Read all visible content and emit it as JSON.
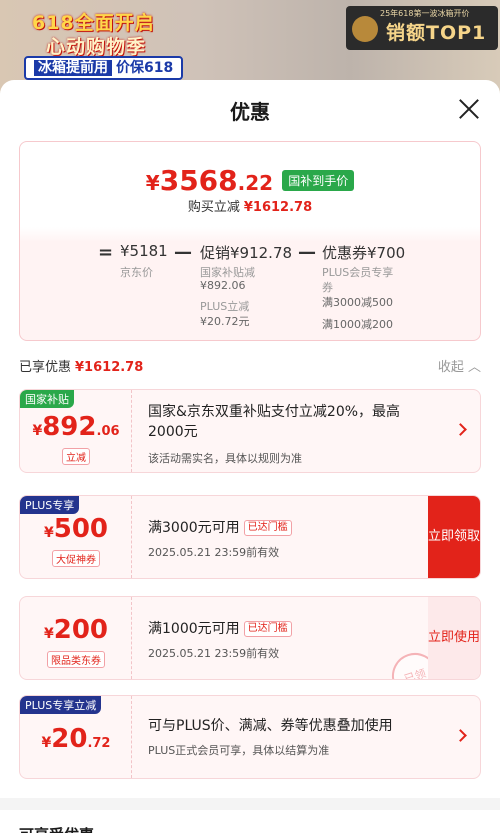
{
  "banner": {
    "left_line1": "618全面开启",
    "left_line2": "心动购物季",
    "left_tag_highlight": "冰箱提前用",
    "left_tag_text": "价保618",
    "right_small": "25年618第一波冰箱开价",
    "right_big": "销额TOP1"
  },
  "sheet": {
    "title": "优惠"
  },
  "price": {
    "symbol": "¥",
    "final_int": "3568",
    "final_dec": ".22",
    "badge": "国补到手价",
    "sub_label": "购买立减",
    "sub_amount": "¥1612.78"
  },
  "formula": {
    "eq": "=",
    "minus": "—",
    "jd_value": "¥5181",
    "jd_label": "京东价",
    "promo_value": "促销¥912.78",
    "promo_sub1_label": "国家补贴减",
    "promo_sub1_value": "¥892.06",
    "promo_sub2_label": "PLUS立减",
    "promo_sub2_value": "¥20.72元",
    "coupon_value": "优惠券¥700",
    "coupon_sub1_label": "PLUS会员专享",
    "coupon_sub1_label2": "券",
    "coupon_sub2": "满3000减500",
    "coupon_sub3": "满1000减200"
  },
  "enjoyed": {
    "label": "已享优惠",
    "amount": "¥1612.78",
    "collapse": "收起"
  },
  "cards": [
    {
      "tag": "国家补贴",
      "symbol": "¥",
      "int": "892",
      "dec": ".06",
      "label": "立减",
      "title_line1": "国家&京东双重补贴支付立减20%，最高",
      "title_line2": "2000元",
      "desc": "该活动需实名，具体以规则为准"
    },
    {
      "tag": "PLUS专享",
      "symbol": "¥",
      "int": "500",
      "dec": "",
      "label": "大促神券",
      "title": "满3000元可用",
      "chip": "已达门槛",
      "desc": "2025.05.21 23:59前有效",
      "button": "立即领取"
    },
    {
      "tag": "",
      "symbol": "¥",
      "int": "200",
      "dec": "",
      "label": "限品类东券",
      "title": "满1000元可用",
      "chip": "已达门槛",
      "desc": "2025.05.21 23:59前有效",
      "button": "立即使用",
      "stamp": "已领"
    },
    {
      "tag": "PLUS专享立减",
      "symbol": "¥",
      "int": "20",
      "dec": ".72",
      "label": "",
      "title": "可与PLUS价、满减、券等优惠叠加使用",
      "desc": "PLUS正式会员可享，具体以结算为准"
    }
  ],
  "bottom": {
    "title": "可享受优惠"
  },
  "colors": {
    "accent_red": "#e2231a",
    "subsidy_green": "#2aa84a",
    "plus_blue": "#24348e"
  }
}
